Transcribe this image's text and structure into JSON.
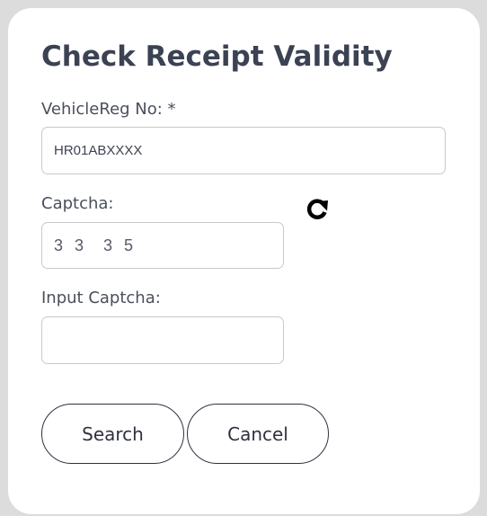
{
  "form": {
    "title": "Check Receipt Validity",
    "vehicle_reg_label": "VehicleReg No: *",
    "vehicle_reg_value": "HR01ABXXXX",
    "captcha_label": "Captcha:",
    "captcha_value": "3 3  3 5",
    "input_captcha_label": "Input Captcha:",
    "input_captcha_value": "",
    "refresh_icon": "refresh-icon",
    "search_label": "Search",
    "cancel_label": "Cancel"
  },
  "colors": {
    "background": "#dcdcdc",
    "card": "#ffffff",
    "title": "#3b4253",
    "border": "#c9c9cc",
    "button_border": "#2f3140"
  }
}
